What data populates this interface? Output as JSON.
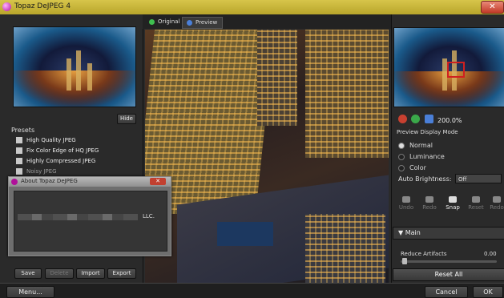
{
  "window": {
    "title": "Topaz DeJPEG 4",
    "close_glyph": "✕"
  },
  "left": {
    "hide_label": "Hide",
    "presets_label": "Presets",
    "presets": [
      "High Quality JPEG",
      "Fix Color Edge of HQ JPEG",
      "Highly Compressed JPEG",
      "Noisy JPEG"
    ],
    "buttons": {
      "save": "Save",
      "delete": "Delete",
      "import": "Import",
      "export": "Export"
    }
  },
  "tabs": {
    "original": "Original",
    "preview": "Preview"
  },
  "right": {
    "zoom": "200.0%",
    "preview_mode_label": "Preview Display Mode",
    "modes": [
      "Normal",
      "Luminance",
      "Color"
    ],
    "selected_mode": "Normal",
    "auto_brightness_label": "Auto Brightness:",
    "auto_brightness_value": "Off",
    "tools": [
      "Undo",
      "Redo",
      "Snap",
      "Reset",
      "Redo"
    ],
    "section": "Main",
    "reduce_label": "Reduce Artifacts",
    "reduce_value": "0.00",
    "reset_all": "Reset All"
  },
  "bottom": {
    "menu": "Menu...",
    "cancel": "Cancel",
    "ok": "OK"
  },
  "about": {
    "title": "About Topaz DeJPEG",
    "close_glyph": "✕",
    "body_text": "LLC."
  },
  "colors": {
    "titlebar": "#c9b63a",
    "accent_purple": "#b0109a",
    "panel": "#2a2a2a"
  }
}
